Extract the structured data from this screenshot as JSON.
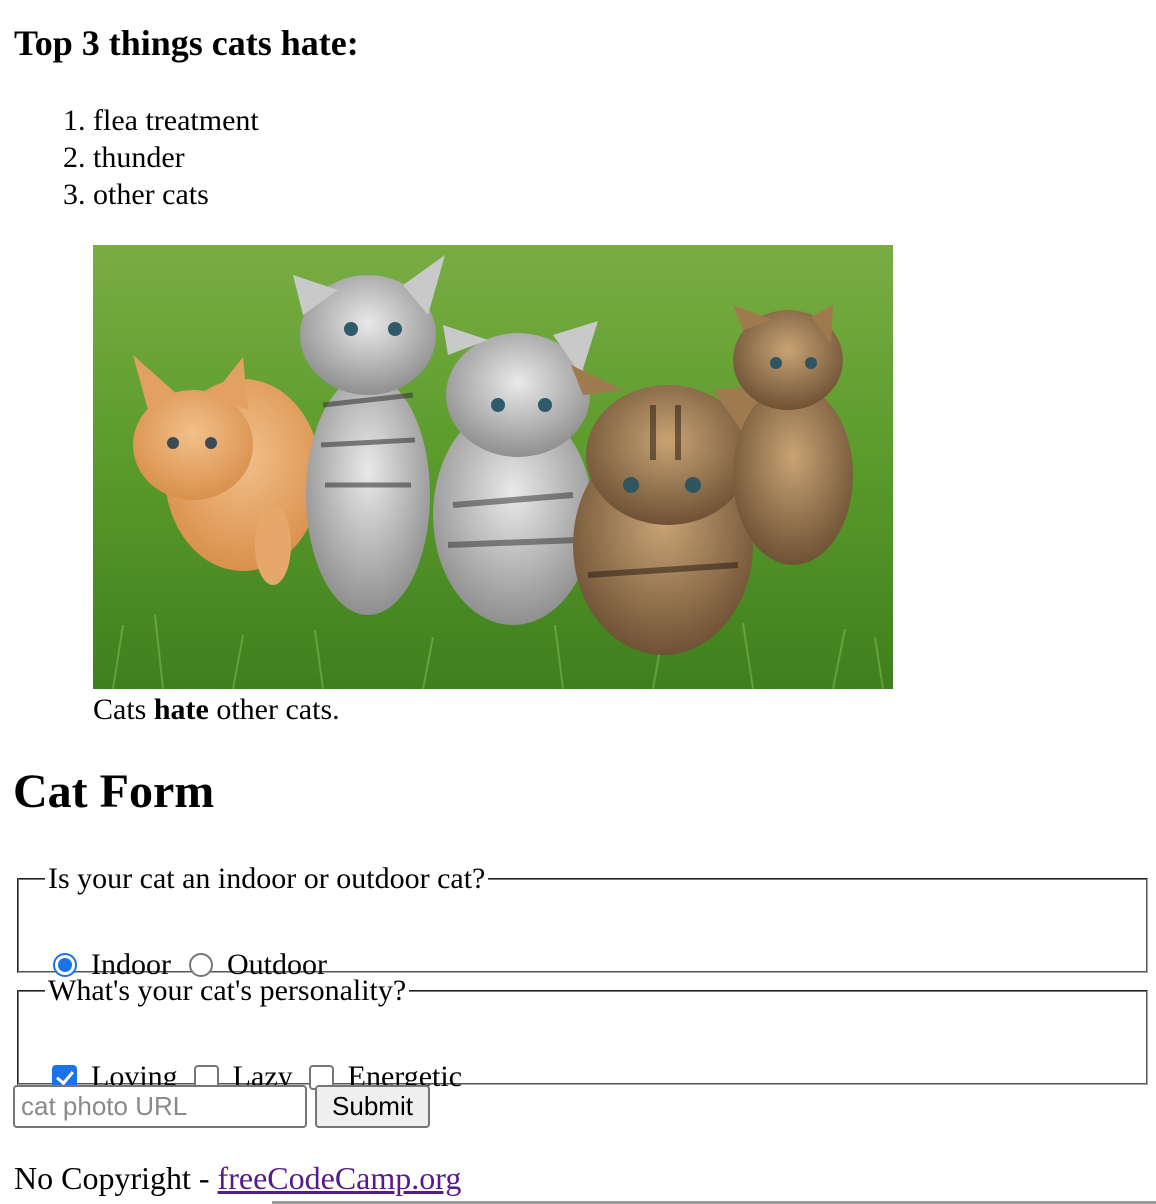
{
  "top_heading": "Top 3 things cats hate:",
  "hate_list": [
    "flea treatment",
    "thunder",
    "other cats"
  ],
  "figure": {
    "image_alt": "Five cats looking around a field.",
    "caption_before": "Cats ",
    "caption_bold": "hate",
    "caption_after": " other cats."
  },
  "form_heading": "Cat Form",
  "indoor_outdoor": {
    "legend": "Is your cat an indoor or outdoor cat?",
    "options": [
      {
        "label": "Indoor",
        "checked": true
      },
      {
        "label": "Outdoor",
        "checked": false
      }
    ]
  },
  "personality": {
    "legend": "What's your cat's personality?",
    "options": [
      {
        "label": "Loving",
        "checked": true
      },
      {
        "label": "Lazy",
        "checked": false
      },
      {
        "label": "Energetic",
        "checked": false
      }
    ]
  },
  "url_input": {
    "value": "",
    "placeholder": "cat photo URL"
  },
  "submit_label": "Submit",
  "footer": {
    "text": "No Copyright - ",
    "link_text": "freeCodeCamp.org"
  },
  "colors": {
    "accent": "#1a73e8",
    "visited_link": "#551a8b"
  }
}
